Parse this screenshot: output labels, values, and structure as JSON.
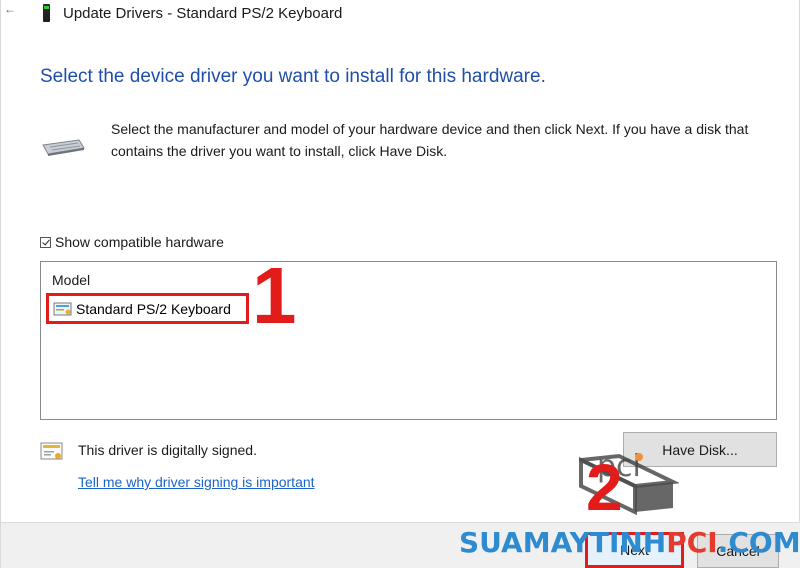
{
  "window": {
    "title": "Update Drivers - Standard PS/2 Keyboard",
    "back_icon": "back-arrow-icon"
  },
  "heading": "Select the device driver you want to install for this hardware.",
  "instructions": "Select the manufacturer and model of your hardware device and then click Next. If you have a disk that contains the driver you want to install, click Have Disk.",
  "show_compatible": {
    "label": "Show compatible hardware",
    "checked": true
  },
  "model_list": {
    "header": "Model",
    "items": [
      {
        "label": "Standard PS/2 Keyboard",
        "selected": true
      }
    ]
  },
  "signature": {
    "status_text": "This driver is digitally signed.",
    "link_text": "Tell me why driver signing is important"
  },
  "buttons": {
    "have_disk": "Have Disk...",
    "next": "Next",
    "cancel": "Cancel"
  },
  "annotations": {
    "step1": "1",
    "step2": "2"
  },
  "watermark": {
    "part1": "SUAMAYTINH",
    "part2": "PCI",
    "part3": ".COM",
    "logo_text": "pci"
  },
  "colors": {
    "heading_blue": "#1f4eaa",
    "link_blue": "#1c64c9",
    "highlight_red": "#e21b1b",
    "watermark_blue": "#2e8bd0",
    "watermark_red": "#e33b2e"
  }
}
